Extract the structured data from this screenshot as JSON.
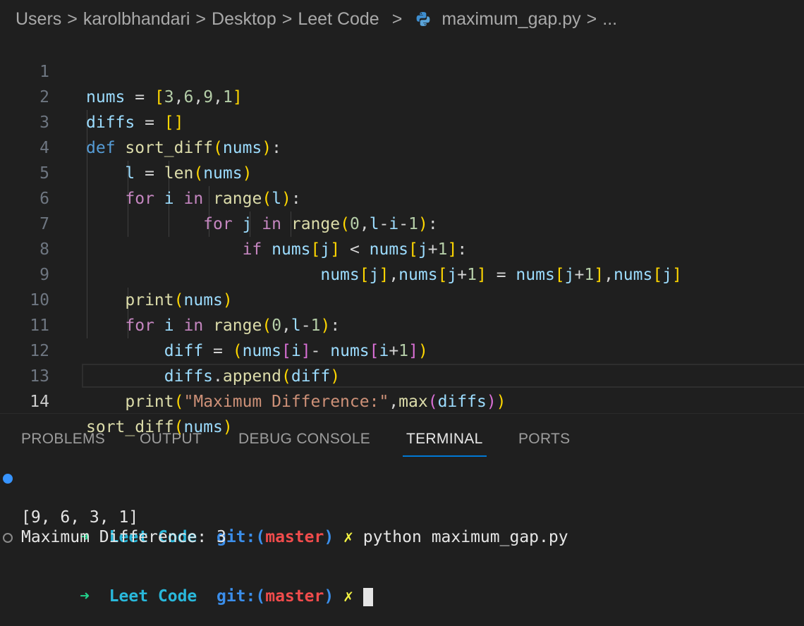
{
  "breadcrumb": {
    "items": [
      "Users",
      "karolbhandari",
      "Desktop",
      "Leet Code",
      "maximum_gap.py",
      "..."
    ],
    "separator": ">"
  },
  "editor": {
    "line_numbers": [
      "1",
      "2",
      "3",
      "4",
      "5",
      "6",
      "7",
      "8",
      "9",
      "10",
      "11",
      "12",
      "13",
      "14"
    ],
    "active_line": "14"
  },
  "panel": {
    "tabs": [
      "PROBLEMS",
      "OUTPUT",
      "DEBUG CONSOLE",
      "TERMINAL",
      "PORTS"
    ],
    "active_tab": "TERMINAL"
  },
  "terminal": {
    "prompt_arrow": "➜",
    "dir": "Leet Code",
    "git_prefix": "git:(",
    "branch": "master",
    "git_suffix": ")",
    "dirty_mark": "✗",
    "command": "python maximum_gap.py",
    "output": [
      "[9, 6, 3, 1]",
      "Maximum Difference: 3"
    ]
  },
  "colors": {
    "accent": "#0078d4",
    "background": "#1f1f1f"
  }
}
